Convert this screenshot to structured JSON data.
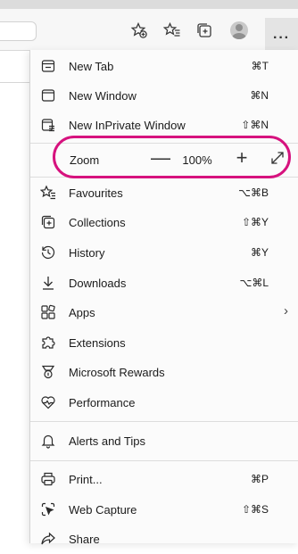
{
  "colors": {
    "highlight": "#d6127e",
    "menu_bg": "#fbfbfb"
  },
  "toolbar": {
    "icons": [
      "add-favorite-icon",
      "favorites-icon",
      "collections-icon",
      "profile-avatar",
      "more-icon"
    ],
    "more_label": "···"
  },
  "menu": {
    "new_tab": {
      "label": "New Tab",
      "shortcut": "⌘T"
    },
    "new_window": {
      "label": "New Window",
      "shortcut": "⌘N"
    },
    "new_inprivate": {
      "label": "New InPrivate Window",
      "shortcut": "⇧⌘N"
    },
    "zoom": {
      "label": "Zoom",
      "minus": "—",
      "value": "100%",
      "plus": "+"
    },
    "favourites": {
      "label": "Favourites",
      "shortcut": "⌥⌘B"
    },
    "collections": {
      "label": "Collections",
      "shortcut": "⇧⌘Y"
    },
    "history": {
      "label": "History",
      "shortcut": "⌘Y"
    },
    "downloads": {
      "label": "Downloads",
      "shortcut": "⌥⌘L"
    },
    "apps": {
      "label": "Apps",
      "chevron": "›"
    },
    "extensions": {
      "label": "Extensions"
    },
    "rewards": {
      "label": "Microsoft Rewards"
    },
    "performance": {
      "label": "Performance"
    },
    "alerts": {
      "label": "Alerts and Tips"
    },
    "print": {
      "label": "Print...",
      "shortcut": "⌘P"
    },
    "web_capture": {
      "label": "Web Capture",
      "shortcut": "⇧⌘S"
    },
    "share": {
      "label": "Share"
    }
  }
}
